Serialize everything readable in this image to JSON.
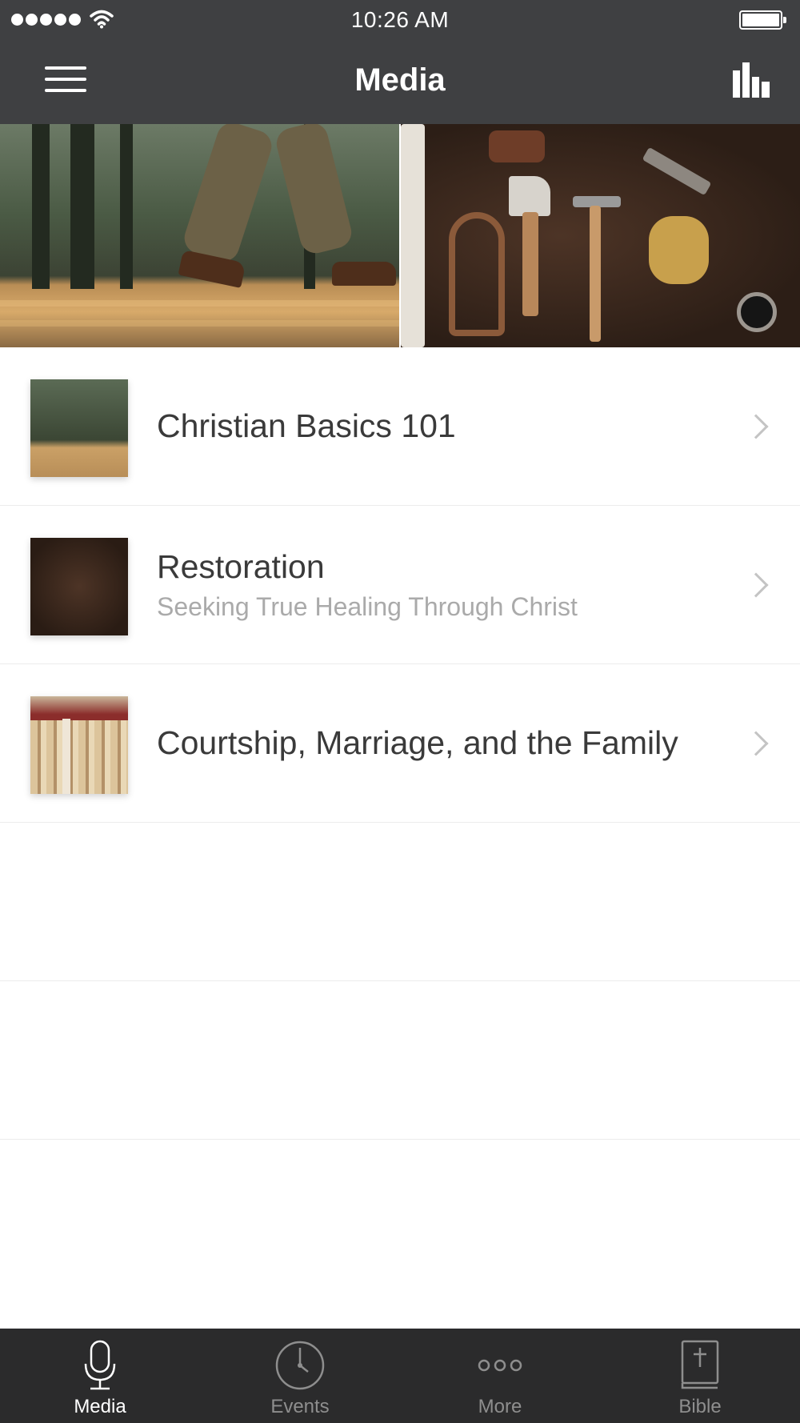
{
  "status_bar": {
    "time": "10:26 AM"
  },
  "nav": {
    "title": "Media",
    "left_icon": "hamburger-menu-icon",
    "right_icon": "bar-chart-icon"
  },
  "hero": {
    "images": [
      "forest-boardwalk-hiker-image",
      "tools-on-wood-table-image"
    ]
  },
  "media_list": [
    {
      "title": "Christian Basics 101",
      "subtitle": "",
      "thumbnail": "forest-boardwalk-thumbnail"
    },
    {
      "title": "Restoration",
      "subtitle": "Seeking True Healing Through Christ",
      "thumbnail": "tools-thumbnail"
    },
    {
      "title": "Courtship, Marriage, and the Family",
      "subtitle": "",
      "thumbnail": "firewood-stack-thumbnail"
    }
  ],
  "tab_bar": {
    "tabs": [
      {
        "label": "Media",
        "icon": "microphone-icon",
        "active": true
      },
      {
        "label": "Events",
        "icon": "clock-icon",
        "active": false
      },
      {
        "label": "More",
        "icon": "more-dots-icon",
        "active": false
      },
      {
        "label": "Bible",
        "icon": "bible-icon",
        "active": false
      }
    ]
  },
  "colors": {
    "header_bg": "#3f4042",
    "tab_bar_bg": "#2b2b2c",
    "active_tab": "#ffffff",
    "inactive_tab": "#8e8e8e",
    "title_text": "#3a3a3a",
    "subtitle_text": "#aaaaaa"
  }
}
